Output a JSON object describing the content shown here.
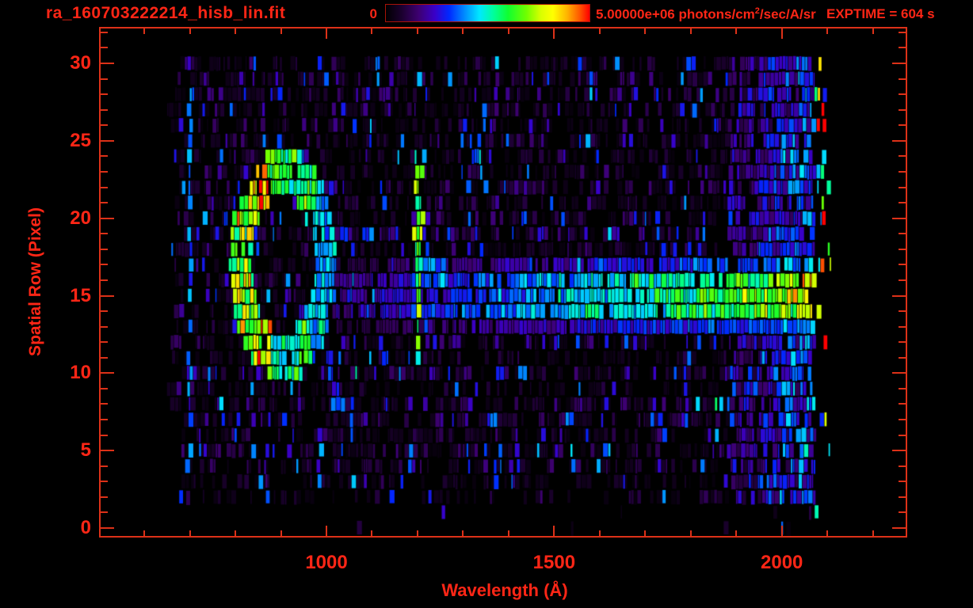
{
  "window": {
    "background_color": "#000000",
    "text_color": "#ff2616",
    "line_color": "#dd3118"
  },
  "header": {
    "title": "ra_160703222214_hisb_lin.fit",
    "colorbar": {
      "min_label": "0",
      "max_label_pre": "5.00000e+06 photons/cm",
      "max_label_sup": "2",
      "max_label_post": "/sec/A/sr",
      "gradient_stops": [
        {
          "pos": 0,
          "color": "#000000"
        },
        {
          "pos": 8,
          "color": "#1c0030"
        },
        {
          "pos": 16,
          "color": "#3d0070"
        },
        {
          "pos": 24,
          "color": "#3a00c8"
        },
        {
          "pos": 31,
          "color": "#0028ff"
        },
        {
          "pos": 39,
          "color": "#0090ff"
        },
        {
          "pos": 46,
          "color": "#00e8ff"
        },
        {
          "pos": 53,
          "color": "#00ff9a"
        },
        {
          "pos": 60,
          "color": "#10ff30"
        },
        {
          "pos": 69,
          "color": "#70ff00"
        },
        {
          "pos": 76,
          "color": "#d8ff00"
        },
        {
          "pos": 82,
          "color": "#ffff00"
        },
        {
          "pos": 89,
          "color": "#ffb400"
        },
        {
          "pos": 95,
          "color": "#ff5a00"
        },
        {
          "pos": 100,
          "color": "#ff0000"
        }
      ]
    },
    "exptime_label": "EXPTIME = 604 s"
  },
  "chart_data": {
    "type": "heatmap",
    "title": "ra_160703222214_hisb_lin.fit",
    "xlabel": "Wavelength (Å)",
    "ylabel": "Spatial Row (Pixel)",
    "x_unit": "Å",
    "y_unit": "pixel row",
    "xlim": [
      504,
      2272
    ],
    "ylim": [
      -0.51,
      32.25
    ],
    "x_major_ticks": [
      1000,
      1500,
      2000
    ],
    "x_minor_tick_step": 100,
    "x_minor_tick_range": [
      600,
      2200
    ],
    "y_major_ticks": [
      0,
      5,
      10,
      15,
      20,
      25,
      30
    ],
    "y_minor_tick_step": 1,
    "y_minor_tick_range": [
      0,
      32
    ],
    "colorbar_range_photons": [
      0,
      5000000
    ],
    "colorbar_units": "photons/cm2/sec/A/sr",
    "exposure_time_s": 604,
    "data_extent": {
      "wavelength_A": [
        648,
        2078
      ],
      "spatial_rows": [
        0,
        30
      ]
    },
    "features": {
      "background_noise": {
        "mean_intensity": 0.062,
        "row_gain_range": [
          0.55,
          1.45
        ],
        "gap_probability": 0.24,
        "blue_streak_probability": 0.05,
        "blue_streak_intensity": 0.26,
        "sparse_bottom_rows": [
          0,
          2
        ]
      },
      "left_emission_line": {
        "wavelength_A": 700,
        "halfwidth_A": 4,
        "rows": [
          5,
          30
        ],
        "intensity": 0.28
      },
      "ring": {
        "center_wavelength_A": 906,
        "center_row": 17.0,
        "radius_wavelength_A": 111,
        "radius_rows": 7.0,
        "radial_band": [
          0.62,
          1.06
        ],
        "base_intensity": 0.36,
        "left_edge_boost": 0.26,
        "top_arc_boost": 0.17,
        "bottom_arc_boost": 0.12
      },
      "ring_tail": {
        "rows": [
          7.5,
          11.8
        ],
        "top_wavelength_A": 1000,
        "drift_A_per_row": 7,
        "halfwidth_A": 11,
        "intensity": 0.27
      },
      "lyman_alpha_line": {
        "center_wavelength_A": 1203,
        "rows": [
          11.6,
          24.3
        ],
        "halfwidth_top_A": 13,
        "halfwidth_bottom_A": 5,
        "intensity": 0.6,
        "cap_intensity": 0.5,
        "faint_tail_rows": [
          10.3,
          11.6
        ],
        "faint_intensity": 0.42
      },
      "blue_blob_near_lya": {
        "wavelength_A": [
          1218,
          1262
        ],
        "rows": [
          15.8,
          17.3
        ],
        "intensity": 0.32
      },
      "blue_blob_upper": {
        "wavelength_A": [
          1316,
          1338
        ],
        "rows": [
          23.8,
          25.6
        ],
        "intensity": 0.32
      },
      "continuum_band": {
        "wavelength_A": [
          1015,
          2078
        ],
        "core_rows": [
          13.1,
          16.4
        ],
        "halo_rows": [
          12.3,
          17.4
        ],
        "intensity_start": 0.16,
        "intensity_end": 0.68,
        "halo_factor": 0.55,
        "red_tip_start_A": 2040,
        "red_tip_boost": 0.2
      },
      "bright_right_zone": {
        "wavelength_A": [
          1885,
          2078
        ],
        "min_row": 1.0,
        "intensity_base": 0.14,
        "intensity_jitter": 0.34
      },
      "saturated_edge_marks": {
        "wavelength_A": [
          2072,
          2108
        ],
        "probability": 0.18,
        "intensity_range": [
          0.3,
          1.0
        ]
      },
      "row_start_jitter_A": [
        648,
        682
      ],
      "row_end_jitter_A": [
        2066,
        2078
      ]
    },
    "render": {
      "seed": 20160703,
      "colormap_stops": [
        [
          0.0,
          "#000000"
        ],
        [
          0.08,
          "#1c0030"
        ],
        [
          0.16,
          "#3d0070"
        ],
        [
          0.24,
          "#3a00c8"
        ],
        [
          0.31,
          "#0028ff"
        ],
        [
          0.39,
          "#0090ff"
        ],
        [
          0.46,
          "#00e8ff"
        ],
        [
          0.53,
          "#00ff9a"
        ],
        [
          0.6,
          "#10ff30"
        ],
        [
          0.69,
          "#70ff00"
        ],
        [
          0.76,
          "#d8ff00"
        ],
        [
          0.82,
          "#ffff00"
        ],
        [
          0.89,
          "#ffb400"
        ],
        [
          0.95,
          "#ff5a00"
        ],
        [
          1.0,
          "#ff0000"
        ]
      ]
    }
  }
}
